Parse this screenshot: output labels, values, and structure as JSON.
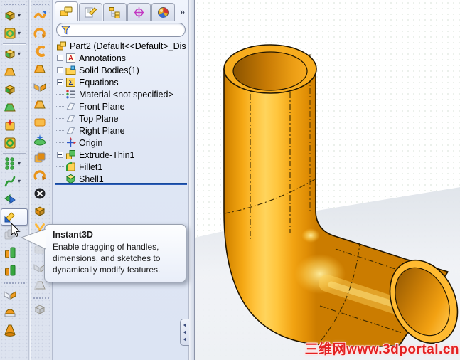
{
  "window": {
    "title": "SolidWorks part editing view"
  },
  "colors": {
    "pipe_orange": "#F5A413",
    "pipe_highlight": "#FFD45C",
    "pipe_shadow": "#C87A00",
    "rollback_blue": "#2B5CB8",
    "watermark_red": "#E32222",
    "panel_bg": "#E4EAF6",
    "toolbar_bg": "#DDE3EF"
  },
  "toolbars": {
    "features_column": {
      "name": "features-toolbar",
      "items": [
        {
          "name": "extruded-boss-icon",
          "kind": "box3d",
          "c1": "#f6c13c",
          "c2": "#46b14e",
          "dropdown": true
        },
        {
          "name": "revolved-boss-icon",
          "kind": "ring",
          "c1": "#f6c13c",
          "c2": "#46b14e",
          "dropdown": true
        },
        {
          "sep": true
        },
        {
          "name": "fillet-icon",
          "kind": "box3d",
          "c1": "#ffd95e",
          "c2": "#46b14e",
          "dropdown": true
        },
        {
          "name": "chamfer-icon",
          "kind": "wedge",
          "c1": "#f3b33a",
          "c2": "#d98d10"
        },
        {
          "name": "shell-feature-icon",
          "kind": "box3d",
          "c1": "#f6c13c",
          "c2": "#35a53d"
        },
        {
          "name": "draft-icon",
          "kind": "wedge",
          "c1": "#57c05f",
          "c2": "#2f9b37"
        },
        {
          "name": "hole-wizard-icon",
          "kind": "star",
          "c1": "#f6c13c",
          "c2": "#d42a2a"
        },
        {
          "name": "simple-hole-icon",
          "kind": "ring",
          "c1": "#f6c13c",
          "c2": "#35a53d"
        },
        {
          "sep": true
        },
        {
          "name": "linear-pattern-icon",
          "kind": "dots6",
          "c1": "#3fae49",
          "c2": "#2e8d36",
          "dropdown": true
        },
        {
          "name": "curves-icon",
          "kind": "squiggle",
          "c1": "#2f9b37",
          "c2": "#2f9b37",
          "dropdown": true
        },
        {
          "name": "deform-icon",
          "kind": "swap",
          "c1": "#3fae49",
          "c2": "#2f6fd0"
        },
        {
          "name": "instant3d-icon",
          "kind": "arrow",
          "c1": "#ffd24a",
          "c2": "#2f6fd0",
          "active": true
        },
        {
          "name": "move-size-icon",
          "kind": "stack",
          "c1": "#c9cdd8",
          "c2": "#b5bac8",
          "disabled": true
        },
        {
          "name": "move-face-icon",
          "kind": "bars2",
          "c1": "#f09a20",
          "c2": "#46b14e"
        },
        {
          "name": "combine-icon",
          "kind": "bars2",
          "c1": "#e88f15",
          "c2": "#35a53d"
        },
        {
          "grip": true
        },
        {
          "name": "mirror-icon",
          "kind": "mirror",
          "c1": "#eef1f6",
          "c2": "#f09a20"
        },
        {
          "name": "dome-icon",
          "kind": "dome",
          "c1": "#dfe3ea",
          "c2": "#f09a20"
        },
        {
          "name": "flex-icon",
          "kind": "flare",
          "c1": "#f09a20",
          "c2": "#d87f08"
        }
      ]
    },
    "sheetmetal_column": {
      "name": "sheetmetal-toolbar",
      "items": [
        {
          "name": "forming-tool-icon",
          "kind": "wave",
          "c1": "#f09a20",
          "c2": "#2f6fd0"
        },
        {
          "name": "hem-icon",
          "kind": "hook",
          "c1": "#f09a20",
          "c2": "#d87f08"
        },
        {
          "name": "base-flange-icon",
          "kind": "cshape",
          "c1": "#f09a20",
          "c2": "#d87f08"
        },
        {
          "name": "edge-flange-icon",
          "kind": "wedge",
          "c1": "#f5ae32",
          "c2": "#d87f08"
        },
        {
          "name": "miter-flange-icon",
          "kind": "mirror",
          "c1": "#f5ae32",
          "c2": "#f09a20"
        },
        {
          "name": "sketched-bend-icon",
          "kind": "wedge",
          "c1": "#f8bc4a",
          "c2": "#d87f08"
        },
        {
          "name": "jog-icon",
          "kind": "flat",
          "c1": "#f8bc4a",
          "c2": "#d87f08"
        },
        {
          "name": "lofted-bend-icon",
          "kind": "hat",
          "c1": "#57c05f",
          "c2": "#2f6fd0"
        },
        {
          "name": "closed-corner-icon",
          "kind": "stack",
          "c1": "#f5ae32",
          "c2": "#e08a10"
        },
        {
          "name": "swept-flange-icon",
          "kind": "hook",
          "c1": "#e8941a",
          "c2": "#c87508"
        },
        {
          "name": "no-bends-icon",
          "kind": "xcircle",
          "c1": "#24262b",
          "c2": "#ffffff"
        },
        {
          "name": "fold-icon",
          "kind": "box3d",
          "c1": "#f5ae32",
          "c2": "#e08a10"
        },
        {
          "name": "rip-icon",
          "kind": "yshape",
          "c1": "#ffb838",
          "c2": "#d87f08"
        },
        {
          "sep": true
        },
        {
          "name": "insert-bends-icon",
          "kind": "flat",
          "c1": "#cdd1da",
          "c2": "#b8bdc9",
          "disabled": true
        },
        {
          "name": "flatten-icon",
          "kind": "mirror",
          "c1": "#cdd1da",
          "c2": "#c2c7d2",
          "disabled": true
        },
        {
          "name": "unfold-icon",
          "kind": "wedge",
          "c1": "#cdd1da",
          "c2": "#b8bdc9",
          "disabled": true
        },
        {
          "grip": true
        },
        {
          "name": "fold-disabled-icon",
          "kind": "box3d",
          "c1": "#cdd1da",
          "c2": "#b8bdc9",
          "disabled": true
        }
      ]
    }
  },
  "panel": {
    "tabs": [
      {
        "name": "featuremanager-tab",
        "kind": "tabFM",
        "active": true
      },
      {
        "name": "propertymanager-tab",
        "kind": "tabPM"
      },
      {
        "name": "configurationmanager-tab",
        "kind": "tabCFG"
      },
      {
        "name": "dimxpertmanager-tab",
        "kind": "tabDIM"
      },
      {
        "name": "displaymanager-tab",
        "kind": "tabDISP"
      }
    ],
    "overflow_chevron": "»",
    "filter": {
      "value": "",
      "placeholder": ""
    },
    "tree": {
      "root": {
        "label": "Part2 (Default<<Default>_Dis",
        "icon": "treePart"
      },
      "items": [
        {
          "label": "Annotations",
          "icon": "treeA",
          "expandable": true
        },
        {
          "label": "Solid Bodies(1)",
          "icon": "treeFolder",
          "expandable": true
        },
        {
          "label": "Equations",
          "icon": "treeSigma",
          "expandable": true
        },
        {
          "label": "Material <not specified>",
          "icon": "treeMat"
        },
        {
          "label": "Front Plane",
          "icon": "treePlane"
        },
        {
          "label": "Top Plane",
          "icon": "treePlane"
        },
        {
          "label": "Right Plane",
          "icon": "treePlane"
        },
        {
          "label": "Origin",
          "icon": "treeOrigin"
        },
        {
          "label": "Extrude-Thin1",
          "icon": "treeExtrude",
          "expandable": true
        },
        {
          "label": "Fillet1",
          "icon": "treeFillet"
        },
        {
          "label": "Shell1",
          "icon": "treeShell"
        }
      ]
    }
  },
  "tooltip": {
    "title": "Instant3D",
    "body": "Enable dragging of handles, dimensions, and sketches to dynamically modify features."
  },
  "viewport": {
    "watermark": "三维网www.3dportal.cn",
    "model": "orange elbow pipe (hollow 90-degree bend tube)"
  }
}
